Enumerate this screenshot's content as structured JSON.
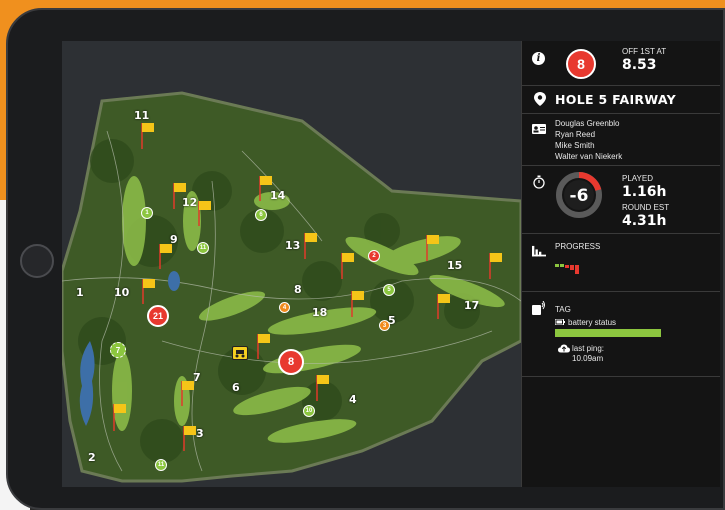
{
  "colors": {
    "accent_red": "#e8392f",
    "battery_green": "#8cc63f",
    "flag_yellow": "#f5c518",
    "marker_green": "#8cc63f",
    "marker_orange": "#f08a1c"
  },
  "panel": {
    "info": {
      "group_badge": "8",
      "off_label": "OFF 1ST AT",
      "off_time": "8.53"
    },
    "location": {
      "title": "HOLE 5 FAIRWAY"
    },
    "players": [
      "Douglas Greenblo",
      "Ryan Reed",
      "Mike Smith",
      "Walter van Niekerk"
    ],
    "score": {
      "value": "-6",
      "played_label": "PLAYED",
      "played_value": "1.16h",
      "round_est_label": "ROUND EST",
      "round_est_value": "4.31h"
    },
    "progress": {
      "label": "PROGRESS"
    },
    "tag": {
      "label": "TAG",
      "battery_label": "battery status",
      "battery_level": 1.0,
      "last_ping_label": "last ping:",
      "last_ping_time": "10.09am"
    }
  },
  "map": {
    "hole_numbers": [
      "11",
      "12",
      "14",
      "9",
      "13",
      "1",
      "10",
      "8",
      "18",
      "15",
      "17",
      "5",
      "7",
      "6",
      "3",
      "4",
      "2"
    ],
    "flags": [
      "10",
      "11",
      "12",
      "8",
      "15",
      "6",
      "18",
      "13",
      "7",
      "16",
      "17",
      "14",
      "4",
      "5",
      "3",
      "6",
      "1",
      "2"
    ],
    "markers": [
      {
        "label": "1",
        "type": "green"
      },
      {
        "label": "6",
        "type": "green"
      },
      {
        "label": "11",
        "type": "green"
      },
      {
        "label": "2",
        "type": "red"
      },
      {
        "label": "5",
        "type": "green"
      },
      {
        "label": "21",
        "type": "red-large"
      },
      {
        "label": "4",
        "type": "orange"
      },
      {
        "label": "3",
        "type": "orange"
      },
      {
        "label": "7",
        "type": "green-burst"
      },
      {
        "label": "8",
        "type": "red-large"
      },
      {
        "label": "10",
        "type": "green"
      },
      {
        "label": "11",
        "type": "green"
      }
    ],
    "cart_icon": "golf-cart-icon"
  }
}
